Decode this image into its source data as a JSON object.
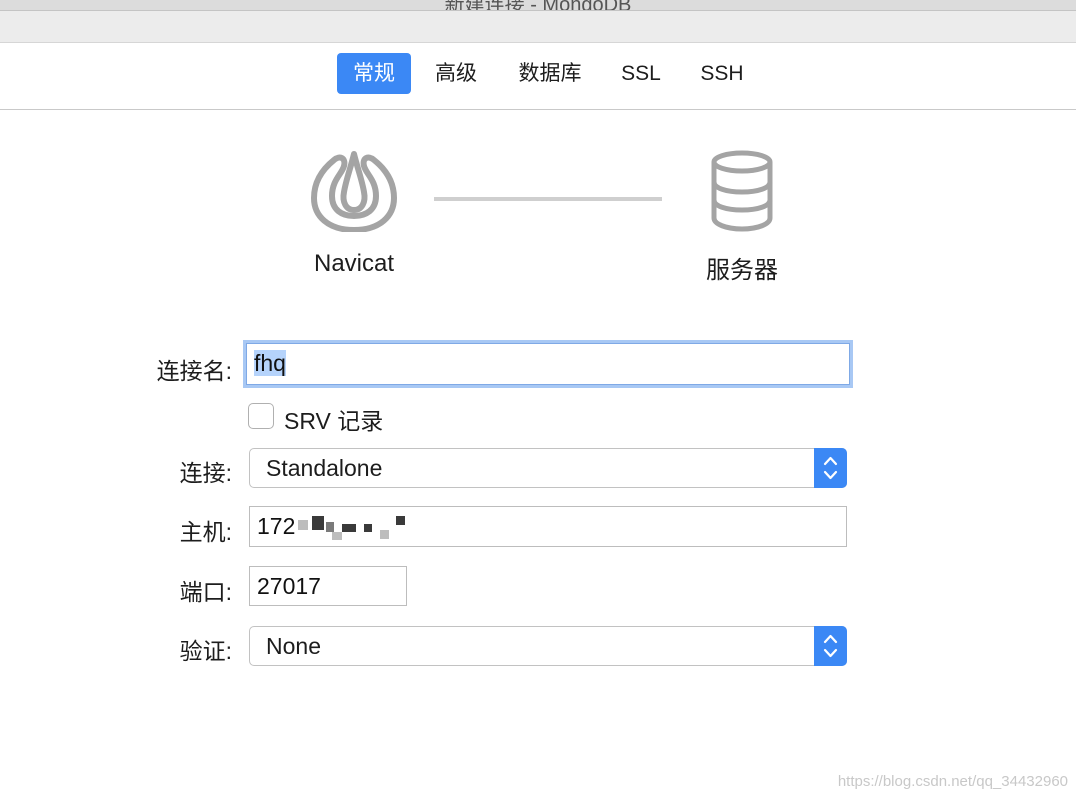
{
  "window": {
    "title": "新建连接 - MongoDB"
  },
  "tabs": [
    {
      "label": "常规",
      "active": true
    },
    {
      "label": "高级",
      "active": false
    },
    {
      "label": "数据库",
      "active": false
    },
    {
      "label": "SSL",
      "active": false
    },
    {
      "label": "SSH",
      "active": false
    }
  ],
  "diagram": {
    "left_label": "Navicat",
    "right_label": "服务器",
    "left_icon": "navicat-logo-icon",
    "right_icon": "database-icon"
  },
  "form": {
    "connection_name": {
      "label": "连接名:",
      "value": "fhq"
    },
    "srv_record": {
      "label": "SRV 记录",
      "checked": false
    },
    "connection": {
      "label": "连接:",
      "value": "Standalone"
    },
    "host": {
      "label": "主机:",
      "value": "172"
    },
    "port": {
      "label": "端口:",
      "value": "27017"
    },
    "auth": {
      "label": "验证:",
      "value": "None"
    }
  },
  "watermark": "https://blog.csdn.net/qq_34432960",
  "colors": {
    "accent": "#3b88f5",
    "focus_ring": "#a8c8f4",
    "selection": "#b5d3fb"
  }
}
